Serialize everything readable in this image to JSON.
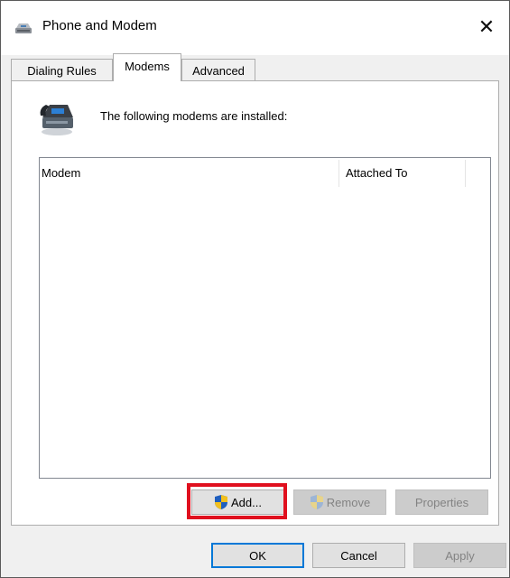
{
  "window": {
    "title": "Phone and Modem",
    "close_glyph": "✕"
  },
  "tabs": [
    {
      "label": "Dialing Rules",
      "active": false
    },
    {
      "label": "Modems",
      "active": true
    },
    {
      "label": "Advanced",
      "active": false
    }
  ],
  "modems_tab": {
    "description": "The following modems are installed:",
    "list": {
      "columns": [
        "Modem",
        "Attached To"
      ],
      "rows": []
    },
    "buttons": {
      "add": "Add...",
      "remove": "Remove",
      "properties": "Properties"
    }
  },
  "footer": {
    "ok": "OK",
    "cancel": "Cancel",
    "apply": "Apply"
  },
  "colors": {
    "highlight": "#e0101e",
    "default_button_border": "#0078d7"
  },
  "icons": {
    "title": "phone-modem-icon",
    "modem": "modem-phone-icon",
    "uac": "uac-shield-icon"
  }
}
